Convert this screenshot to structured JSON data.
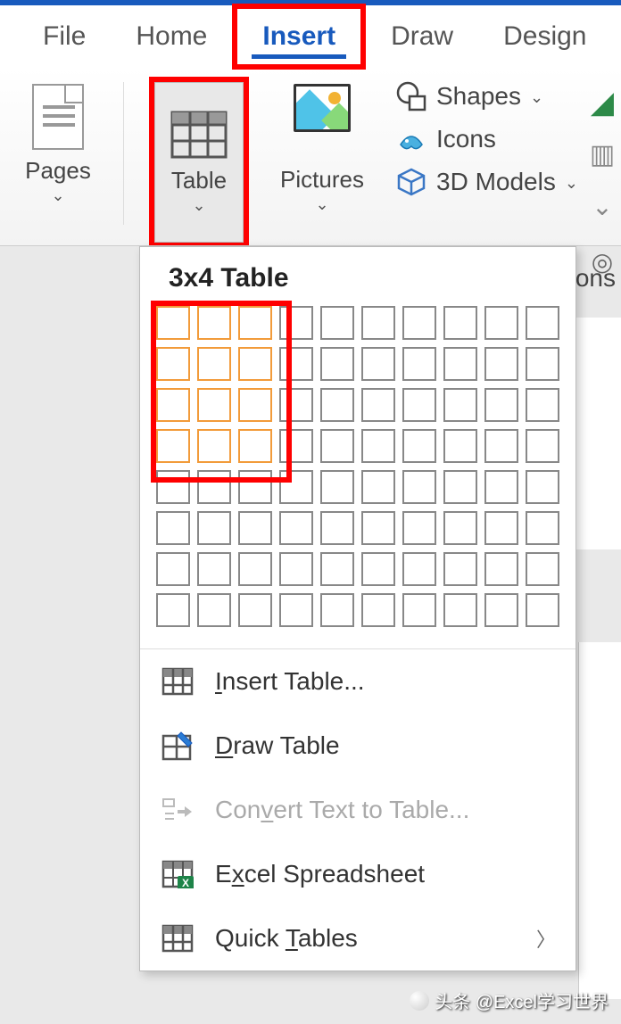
{
  "tabs": {
    "file": "File",
    "home": "Home",
    "insert": "Insert",
    "draw": "Draw",
    "design": "Design"
  },
  "ribbon": {
    "pages": "Pages",
    "table": "Table",
    "pictures": "Pictures",
    "shapes": "Shapes",
    "icons": "Icons",
    "models3d": "3D Models",
    "dropdown_chev": "⌄"
  },
  "dropdown": {
    "title": "3x4 Table",
    "selected_cols": 3,
    "selected_rows": 4,
    "grid_cols": 10,
    "grid_rows": 8,
    "menu": {
      "insert_table": "Insert Table...",
      "draw_table": "Draw Table",
      "convert": "Convert Text to Table...",
      "excel": "Excel Spreadsheet",
      "quick": "Quick Tables"
    }
  },
  "fragments": {
    "ons": "ons"
  },
  "watermark": "头条 @Excel学习世界"
}
